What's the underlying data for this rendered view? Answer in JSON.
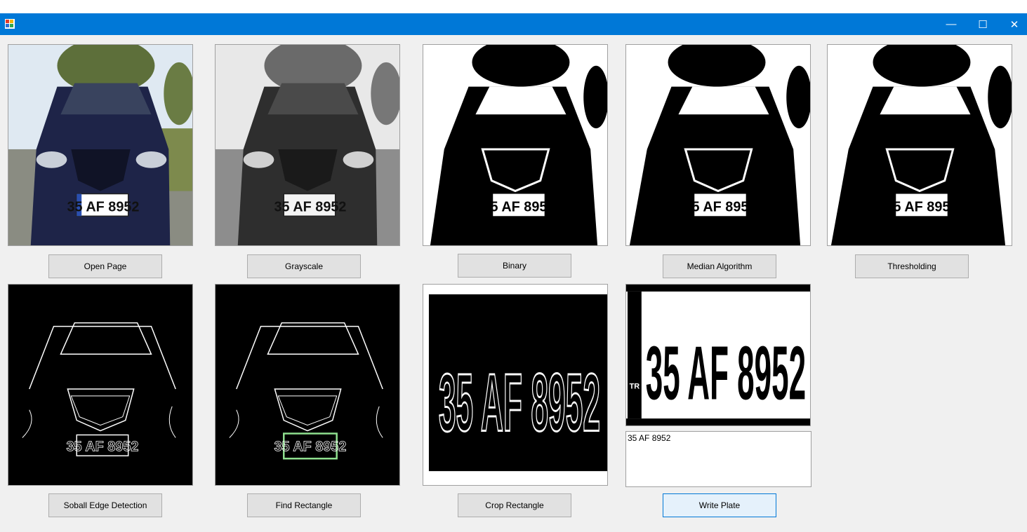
{
  "window": {
    "minimize_glyph": "—",
    "maximize_glyph": "☐",
    "close_glyph": "✕"
  },
  "plate_number": "35 AF 8952",
  "plate_prefix": "TR",
  "buttons": {
    "open": "Open Page",
    "grayscale": "Grayscale",
    "binary": "Binary",
    "median": "Median Algorithm",
    "thresholding": "Thresholding",
    "sobel": "Soball Edge Detection",
    "find_rect": "Find Rectangle",
    "crop_rect": "Crop Rectangle",
    "write_plate": "Write Plate"
  },
  "output_text": "35 AF 8952",
  "colors": {
    "titlebar": "#0078d7",
    "car_body": "#1e2448",
    "sky": "#dfe9f2",
    "detected_rectangle": "#8fe08f"
  }
}
